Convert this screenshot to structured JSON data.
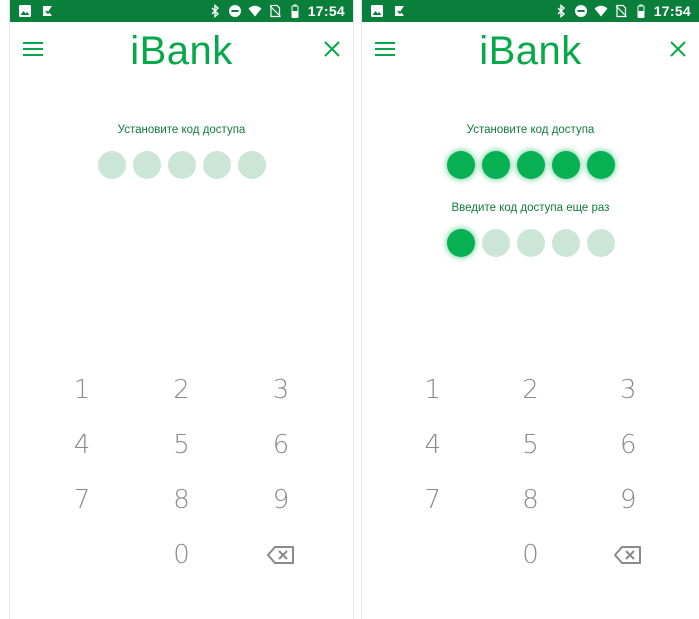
{
  "screens": [
    {
      "id": "left",
      "status_bar": {
        "time": "17:54"
      },
      "app_bar": {
        "title": "iBank"
      },
      "prompt_set": "Установите код доступа",
      "set_filled": 0,
      "prompt_confirm": null,
      "confirm_filled": null,
      "keypad": {
        "keys": [
          "1",
          "2",
          "3",
          "4",
          "5",
          "6",
          "7",
          "8",
          "9",
          "0"
        ]
      }
    },
    {
      "id": "right",
      "status_bar": {
        "time": "17:54"
      },
      "app_bar": {
        "title": "iBank"
      },
      "prompt_set": "Установите код доступа",
      "set_filled": 5,
      "prompt_confirm": "Введите код доступа еще раз",
      "confirm_filled": 1,
      "keypad": {
        "keys": [
          "1",
          "2",
          "3",
          "4",
          "5",
          "6",
          "7",
          "8",
          "9",
          "0"
        ]
      }
    }
  ],
  "pin_length": 5,
  "icons": {
    "status_left": [
      "image-icon",
      "notification-check-icon"
    ],
    "status_right": [
      "bluetooth-icon",
      "do-not-disturb-icon",
      "wifi-icon",
      "no-sim-icon",
      "battery-icon"
    ],
    "menu": "menu-icon",
    "close": "close-icon",
    "backspace": "backspace-icon"
  },
  "colors": {
    "status_bar": "#0a7f3b",
    "brand": "#07a84a",
    "dot_empty": "#cbe6d6",
    "dot_filled": "#06b053",
    "prompt_text": "#127a3d",
    "key_text": "#8a8a8a"
  }
}
